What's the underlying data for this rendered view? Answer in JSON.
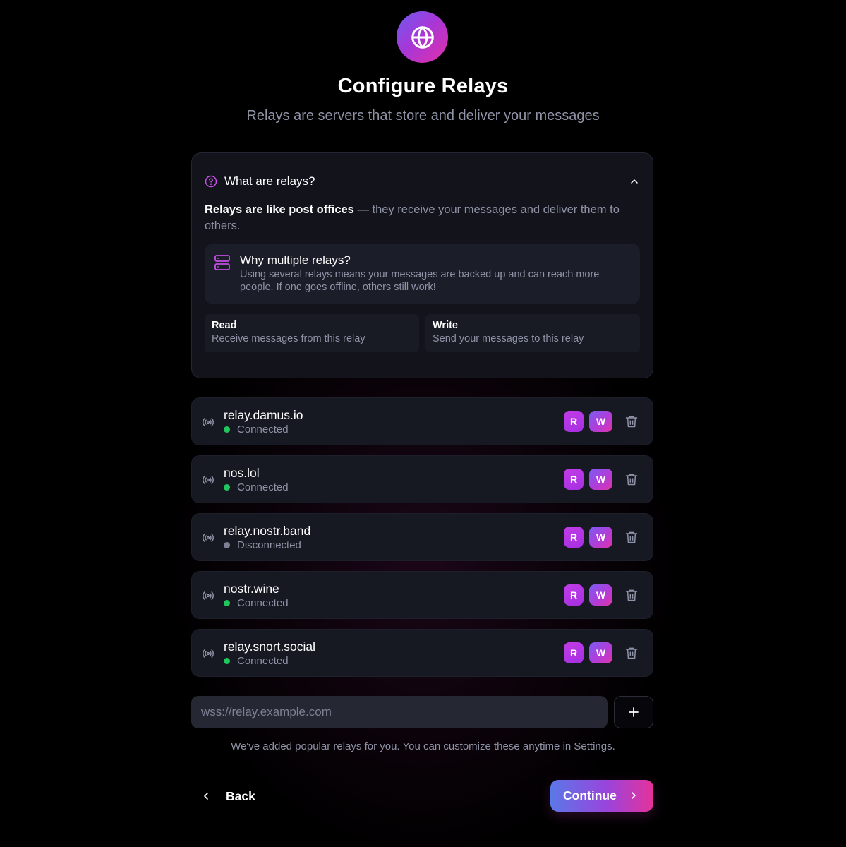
{
  "header": {
    "title": "Configure Relays",
    "subtitle": "Relays are servers that store and deliver your messages"
  },
  "info": {
    "toggle_label": "What are relays?",
    "intro_bold": "Relays are like post offices",
    "intro_rest": " — they receive your messages and deliver them to others.",
    "why_title": "Why multiple relays?",
    "why_desc": "Using several relays means your messages are backed up and can reach more people. If one goes offline, others still work!",
    "read_title": "Read",
    "read_desc": "Receive messages from this relay",
    "write_title": "Write",
    "write_desc": "Send your messages to this relay"
  },
  "relays": [
    {
      "name": "relay.damus.io",
      "status": "Connected",
      "read_badge": "R",
      "write_badge": "W"
    },
    {
      "name": "nos.lol",
      "status": "Connected",
      "read_badge": "R",
      "write_badge": "W"
    },
    {
      "name": "relay.nostr.band",
      "status": "Disconnected",
      "read_badge": "R",
      "write_badge": "W"
    },
    {
      "name": "nostr.wine",
      "status": "Connected",
      "read_badge": "R",
      "write_badge": "W"
    },
    {
      "name": "relay.snort.social",
      "status": "Connected",
      "read_badge": "R",
      "write_badge": "W"
    }
  ],
  "add_relay": {
    "placeholder": "wss://relay.example.com",
    "value": ""
  },
  "hint": "We've added popular relays for you. You can customize these anytime in Settings.",
  "nav": {
    "back_label": "Back",
    "continue_label": "Continue"
  },
  "colors": {
    "accent_purple": "#b23cd8",
    "accent_pink": "#e22fa8",
    "connected": "#22c55e",
    "disconnected": "#7b8094",
    "muted_text": "#8f93a6"
  }
}
